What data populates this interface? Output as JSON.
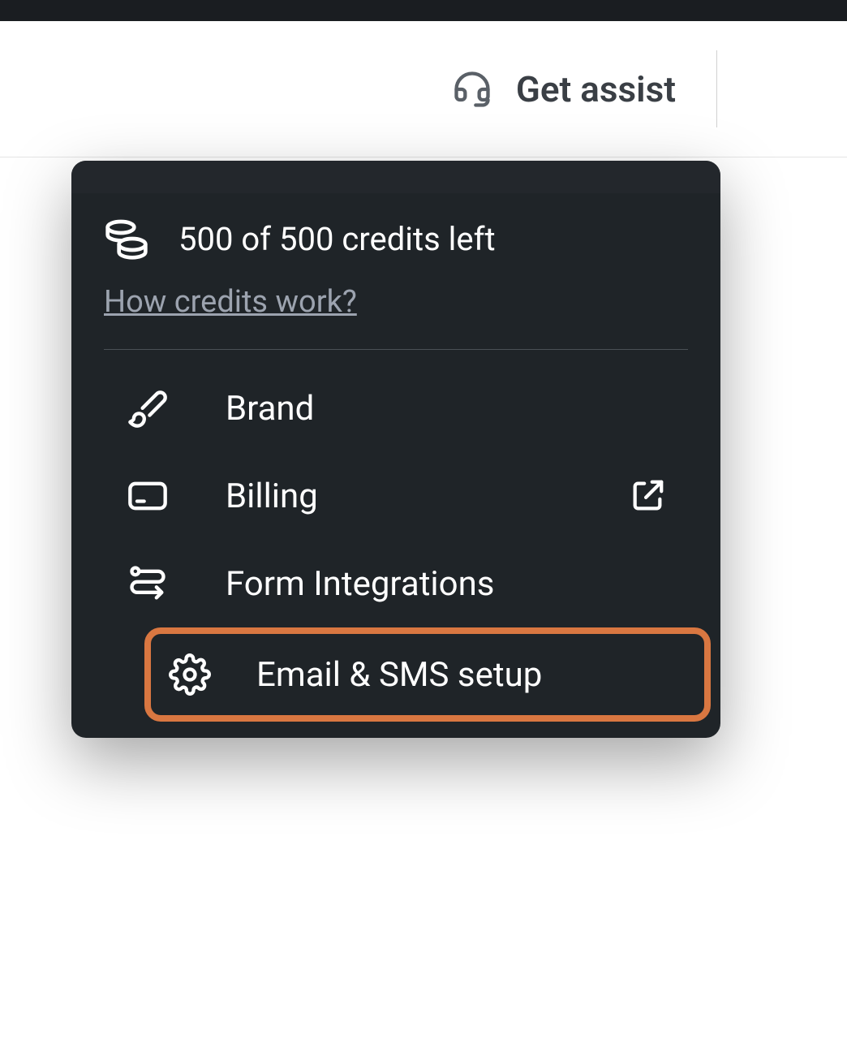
{
  "header": {
    "assist_label": "Get assist"
  },
  "dropdown": {
    "credits_text": "500 of 500 credits left",
    "credits_link": "How credits work?",
    "items": [
      {
        "label": "Brand"
      },
      {
        "label": "Billing"
      },
      {
        "label": "Form Integrations"
      },
      {
        "label": "Email & SMS setup"
      }
    ]
  }
}
